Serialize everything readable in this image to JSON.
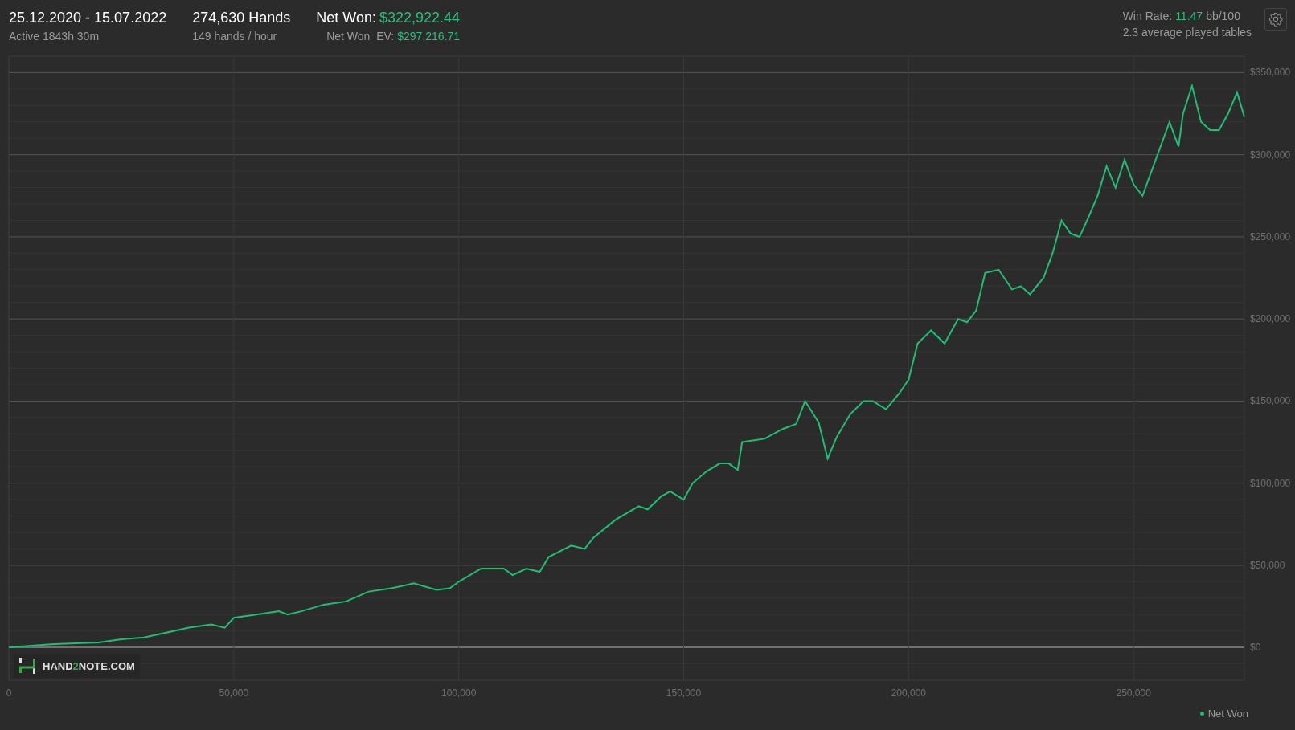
{
  "header": {
    "date_range": "25.12.2020 - 15.07.2022",
    "active_time": "Active 1843h 30m",
    "hands": "274,630 Hands",
    "hands_per_hour": "149 hands / hour",
    "net_won": {
      "label": "Net Won:",
      "value": "$322,922.44"
    },
    "net_won_ev": {
      "label": "Net Won  EV:",
      "value": "$297,216.71"
    },
    "win_rate": {
      "label": "Win Rate:",
      "value": "11.47",
      "unit": "bb/100"
    },
    "avg_tables": "2.3 average played tables"
  },
  "logo": {
    "text": "HAND**2**NOTE.COM"
  },
  "chart": {
    "chart_data": {
      "type": "line",
      "grid": true,
      "xlim": [
        0,
        274630
      ],
      "ylim": [
        -20000,
        360000
      ],
      "xticks": [
        {
          "value": 0,
          "label": "0"
        },
        {
          "value": 50000,
          "label": "50,000"
        },
        {
          "value": 100000,
          "label": "100,000"
        },
        {
          "value": 150000,
          "label": "150,000"
        },
        {
          "value": 200000,
          "label": "200,000"
        },
        {
          "value": 250000,
          "label": "250,000"
        }
      ],
      "yticks": [
        {
          "value": 0,
          "label": "$0"
        },
        {
          "value": 50000,
          "label": "$50,000"
        },
        {
          "value": 100000,
          "label": "$100,000"
        },
        {
          "value": 150000,
          "label": "$150,000"
        },
        {
          "value": 200000,
          "label": "$200,000"
        },
        {
          "value": 250000,
          "label": "$250,000"
        },
        {
          "value": 300000,
          "label": "$300,000"
        },
        {
          "value": 350000,
          "label": "$350,000"
        }
      ],
      "x": [
        0,
        5000,
        10000,
        20000,
        25000,
        30000,
        35000,
        40000,
        45000,
        48000,
        50000,
        55000,
        60000,
        62000,
        65000,
        70000,
        75000,
        80000,
        85000,
        90000,
        95000,
        98000,
        100000,
        105000,
        110000,
        112000,
        115000,
        118000,
        120000,
        125000,
        128000,
        130000,
        135000,
        140000,
        142000,
        145000,
        147000,
        150000,
        152000,
        155000,
        158000,
        160000,
        162000,
        163000,
        168000,
        172000,
        175000,
        177000,
        180000,
        182000,
        184000,
        187000,
        190000,
        192000,
        195000,
        198000,
        200000,
        202000,
        205000,
        208000,
        211000,
        213000,
        215000,
        217000,
        220000,
        223000,
        225000,
        227000,
        230000,
        232000,
        234000,
        236000,
        238000,
        240000,
        242000,
        244000,
        246000,
        248000,
        250000,
        252000,
        254000,
        256000,
        258000,
        260000,
        261000,
        263000,
        265000,
        267000,
        269000,
        271000,
        273000,
        274630
      ],
      "series": [
        {
          "name": "Net Won",
          "color": "#1fbf73",
          "values": [
            0,
            1000,
            2000,
            3000,
            5000,
            6000,
            9000,
            12000,
            14000,
            12000,
            18000,
            20000,
            22000,
            20000,
            22000,
            26000,
            28000,
            34000,
            36000,
            39000,
            35000,
            36000,
            40000,
            48000,
            48000,
            44000,
            48000,
            46000,
            55000,
            62000,
            60000,
            67000,
            78000,
            86000,
            84000,
            92000,
            95000,
            90000,
            100000,
            107000,
            112000,
            112000,
            108000,
            125000,
            127000,
            133000,
            136000,
            150000,
            137000,
            115000,
            128000,
            142000,
            150000,
            150000,
            145000,
            155000,
            163000,
            185000,
            193000,
            185000,
            200000,
            198000,
            205000,
            228000,
            230000,
            218000,
            220000,
            215000,
            225000,
            240000,
            260000,
            252000,
            250000,
            262000,
            275000,
            293000,
            280000,
            297000,
            282000,
            275000,
            290000,
            305000,
            320000,
            305000,
            325000,
            342000,
            320000,
            315000,
            315000,
            325000,
            338000,
            323000
          ]
        }
      ]
    }
  }
}
